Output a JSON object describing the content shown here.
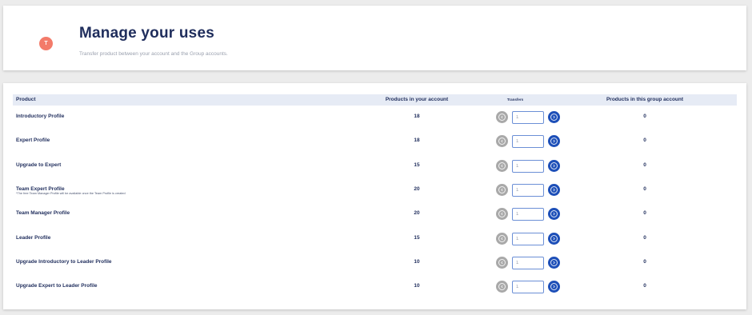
{
  "header": {
    "avatar_letter": "T",
    "title": "Manage your uses",
    "subtitle": "Transfer product between your account and the Group accounts."
  },
  "table": {
    "columns": {
      "product": "Product",
      "your_account": "Products in your account",
      "transfers": "Transfers",
      "group_account": "Products in this group account"
    },
    "rows": [
      {
        "name": "Introductory Profile",
        "note": "",
        "your": "18",
        "qty": "1",
        "group": "0"
      },
      {
        "name": "Expert Profile",
        "note": "",
        "your": "18",
        "qty": "1",
        "group": "0"
      },
      {
        "name": "Upgrade to Expert",
        "note": "",
        "your": "15",
        "qty": "1",
        "group": "0"
      },
      {
        "name": "Team Expert Profile",
        "note": "*The free Team Manager Profile will be available once the Team Profile is created",
        "your": "20",
        "qty": "1",
        "group": "0"
      },
      {
        "name": "Team Manager Profile",
        "note": "",
        "your": "20",
        "qty": "1",
        "group": "0"
      },
      {
        "name": "Leader Profile",
        "note": "",
        "your": "15",
        "qty": "1",
        "group": "0"
      },
      {
        "name": "Upgrade Introductory to Leader Profile",
        "note": "",
        "your": "10",
        "qty": "1",
        "group": "0"
      },
      {
        "name": "Upgrade Expert to Leader Profile",
        "note": "",
        "your": "10",
        "qty": "1",
        "group": "0"
      }
    ]
  },
  "icons": {
    "transfer_left": "arrow-left-circle-icon",
    "transfer_right": "arrow-right-circle-icon"
  },
  "colors": {
    "title": "#1f2d5c",
    "avatar": "#f37b6a",
    "header_row_bg": "#e6ebf5",
    "button_disabled": "#a9a9a9",
    "button_primary": "#1d4fb8",
    "input_border": "#6b8fd6"
  }
}
